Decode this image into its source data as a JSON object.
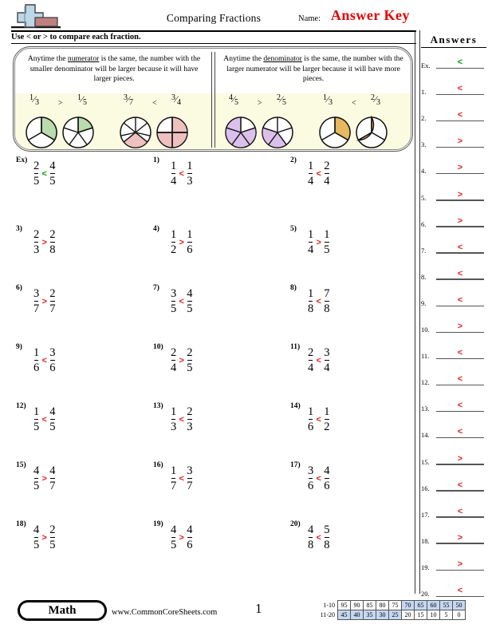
{
  "header": {
    "title": "Comparing Fractions",
    "name_label": "Name:",
    "answer_key": "Answer Key",
    "instruction": "Use < or > to compare each fraction.",
    "logo_icon": "plus-minus-icon"
  },
  "help_box": {
    "left": {
      "text_line1": "Anytime the ",
      "keyword": "numerator",
      "text_line2": " is the same, the number with the smaller denominator will be larger because it will have larger pieces.",
      "examples": [
        {
          "left_num": "1",
          "left_den": "3",
          "op": ">",
          "right_num": "1",
          "right_den": "5",
          "color": "#b9dcae"
        },
        {
          "left_num": "3",
          "left_den": "7",
          "op": "<",
          "right_num": "3",
          "right_den": "4",
          "color": "#eec0c0"
        }
      ]
    },
    "right": {
      "text_line1": "Anytime the ",
      "keyword": "denominator",
      "text_line2": " is the same, the number with the larger numerator will be larger because it will have more pieces.",
      "examples": [
        {
          "left_num": "4",
          "left_den": "5",
          "op": ">",
          "right_num": "2",
          "right_den": "5",
          "color": "#dcc0ec"
        },
        {
          "left_num": "1",
          "left_den": "3",
          "op": "<",
          "right_num": "2",
          "right_den": "3",
          "color": "#e6b košt"
        }
      ]
    }
  },
  "problems": [
    {
      "label": "Ex)",
      "n1": "2",
      "d1": "5",
      "op": "<",
      "n2": "4",
      "d2": "5",
      "example": true
    },
    {
      "label": "1)",
      "n1": "1",
      "d1": "4",
      "op": "<",
      "n2": "1",
      "d2": "3",
      "example": false
    },
    {
      "label": "2)",
      "n1": "1",
      "d1": "4",
      "op": "<",
      "n2": "2",
      "d2": "4",
      "example": false
    },
    {
      "label": "3)",
      "n1": "2",
      "d1": "3",
      "op": ">",
      "n2": "2",
      "d2": "8",
      "example": false
    },
    {
      "label": "4)",
      "n1": "1",
      "d1": "2",
      "op": ">",
      "n2": "1",
      "d2": "6",
      "example": false
    },
    {
      "label": "5)",
      "n1": "1",
      "d1": "4",
      "op": ">",
      "n2": "1",
      "d2": "5",
      "example": false
    },
    {
      "label": "6)",
      "n1": "3",
      "d1": "7",
      "op": ">",
      "n2": "2",
      "d2": "7",
      "example": false
    },
    {
      "label": "7)",
      "n1": "3",
      "d1": "5",
      "op": "<",
      "n2": "4",
      "d2": "5",
      "example": false
    },
    {
      "label": "8)",
      "n1": "1",
      "d1": "8",
      "op": "<",
      "n2": "7",
      "d2": "8",
      "example": false
    },
    {
      "label": "9)",
      "n1": "1",
      "d1": "6",
      "op": "<",
      "n2": "3",
      "d2": "6",
      "example": false
    },
    {
      "label": "10)",
      "n1": "2",
      "d1": "4",
      "op": ">",
      "n2": "2",
      "d2": "5",
      "example": false
    },
    {
      "label": "11)",
      "n1": "2",
      "d1": "4",
      "op": "<",
      "n2": "3",
      "d2": "4",
      "example": false
    },
    {
      "label": "12)",
      "n1": "1",
      "d1": "5",
      "op": "<",
      "n2": "4",
      "d2": "5",
      "example": false
    },
    {
      "label": "13)",
      "n1": "1",
      "d1": "3",
      "op": "<",
      "n2": "2",
      "d2": "3",
      "example": false
    },
    {
      "label": "14)",
      "n1": "1",
      "d1": "6",
      "op": "<",
      "n2": "1",
      "d2": "2",
      "example": false
    },
    {
      "label": "15)",
      "n1": "4",
      "d1": "5",
      "op": ">",
      "n2": "4",
      "d2": "7",
      "example": false
    },
    {
      "label": "16)",
      "n1": "1",
      "d1": "7",
      "op": "<",
      "n2": "3",
      "d2": "7",
      "example": false
    },
    {
      "label": "17)",
      "n1": "3",
      "d1": "6",
      "op": "<",
      "n2": "4",
      "d2": "6",
      "example": false
    },
    {
      "label": "18)",
      "n1": "4",
      "d1": "5",
      "op": ">",
      "n2": "2",
      "d2": "5",
      "example": false
    },
    {
      "label": "19)",
      "n1": "4",
      "d1": "5",
      "op": ">",
      "n2": "4",
      "d2": "6",
      "example": false
    },
    {
      "label": "20)",
      "n1": "4",
      "d1": "8",
      "op": "<",
      "n2": "5",
      "d2": "8",
      "example": false
    }
  ],
  "answers": {
    "title": "Answers",
    "rows": [
      {
        "num": "Ex.",
        "value": "<",
        "example": true
      },
      {
        "num": "1.",
        "value": "<",
        "example": false
      },
      {
        "num": "2.",
        "value": "<",
        "example": false
      },
      {
        "num": "3.",
        "value": ">",
        "example": false
      },
      {
        "num": "4.",
        "value": ">",
        "example": false
      },
      {
        "num": "5.",
        "value": ">",
        "example": false
      },
      {
        "num": "6.",
        "value": ">",
        "example": false
      },
      {
        "num": "7.",
        "value": "<",
        "example": false
      },
      {
        "num": "8.",
        "value": "<",
        "example": false
      },
      {
        "num": "9.",
        "value": "<",
        "example": false
      },
      {
        "num": "10.",
        "value": ">",
        "example": false
      },
      {
        "num": "11.",
        "value": "<",
        "example": false
      },
      {
        "num": "12.",
        "value": "<",
        "example": false
      },
      {
        "num": "13.",
        "value": "<",
        "example": false
      },
      {
        "num": "14.",
        "value": "<",
        "example": false
      },
      {
        "num": "15.",
        "value": ">",
        "example": false
      },
      {
        "num": "16.",
        "value": "<",
        "example": false
      },
      {
        "num": "17.",
        "value": "<",
        "example": false
      },
      {
        "num": "18.",
        "value": ">",
        "example": false
      },
      {
        "num": "19.",
        "value": ">",
        "example": false
      },
      {
        "num": "20.",
        "value": "<",
        "example": false
      }
    ]
  },
  "footer": {
    "subject_badge": "Math",
    "site_url": "www.CommonCoreSheets.com",
    "page_number": "1",
    "score_table": {
      "row1_label": "1-10",
      "row2_label": "11-20",
      "row1": [
        "95",
        "90",
        "85",
        "80",
        "75",
        "70",
        "65",
        "60",
        "55",
        "50"
      ],
      "row2": [
        "45",
        "40",
        "35",
        "30",
        "25",
        "20",
        "15",
        "10",
        "5",
        "0"
      ],
      "row1_shaded": [
        false,
        false,
        false,
        false,
        false,
        true,
        true,
        true,
        true,
        true
      ],
      "row2_shaded": [
        true,
        true,
        true,
        true,
        true,
        false,
        false,
        false,
        false,
        false
      ]
    }
  },
  "colors": {
    "answer_red": "#e02020",
    "example_green": "#00a000",
    "answer_key_red": "#e60000",
    "shade_blue": "#c5d8f2",
    "help_yellow": "#fbfbe2"
  }
}
